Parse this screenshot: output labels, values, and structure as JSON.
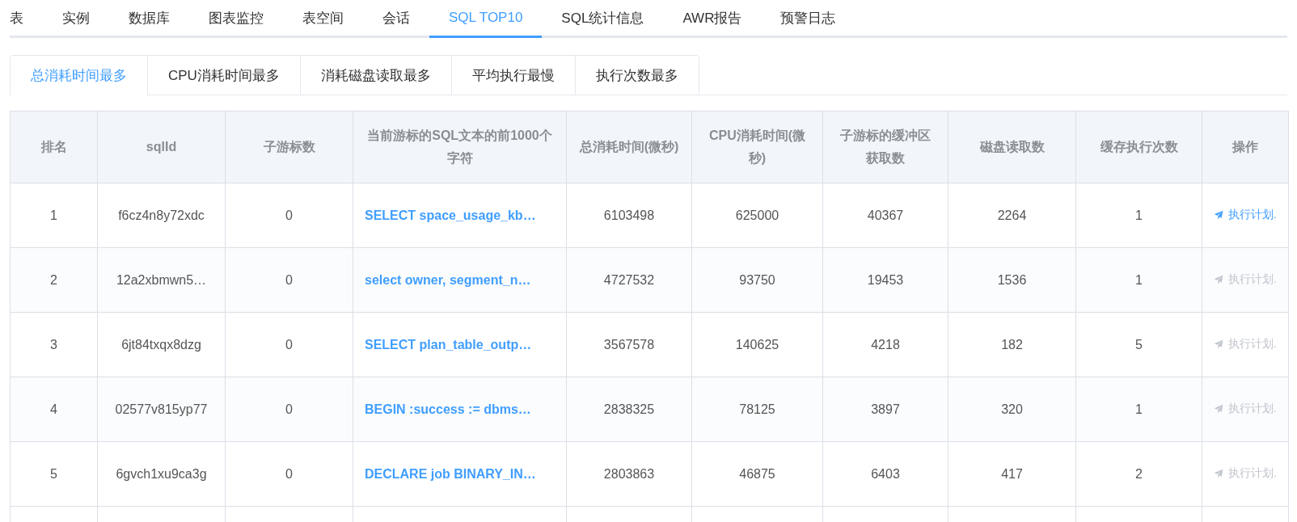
{
  "nav_tabs": [
    {
      "label": "表",
      "selected": false
    },
    {
      "label": "实例",
      "selected": false
    },
    {
      "label": "数据库",
      "selected": false
    },
    {
      "label": "图表监控",
      "selected": false
    },
    {
      "label": "表空间",
      "selected": false
    },
    {
      "label": "会话",
      "selected": false
    },
    {
      "label": "SQL TOP10",
      "selected": true
    },
    {
      "label": "SQL统计信息",
      "selected": false
    },
    {
      "label": "AWR报告",
      "selected": false
    },
    {
      "label": "预警日志",
      "selected": false
    }
  ],
  "sub_tabs": [
    {
      "label": "总消耗时间最多",
      "selected": true
    },
    {
      "label": "CPU消耗时间最多",
      "selected": false
    },
    {
      "label": "消耗磁盘读取最多",
      "selected": false
    },
    {
      "label": "平均执行最慢",
      "selected": false
    },
    {
      "label": "执行次数最多",
      "selected": false
    }
  ],
  "table": {
    "columns": [
      "排名",
      "sqlId",
      "子游标数",
      "当前游标的SQL文本的前1000个字符",
      "总消耗时间(微秒)",
      "CPU消耗时间(微秒)",
      "子游标的缓冲区获取数",
      "磁盘读取数",
      "缓存执行次数",
      "操作"
    ],
    "rows": [
      {
        "rank": "1",
        "sql_id": "f6cz4n8y72xdc",
        "child_cursors": "0",
        "sql_text": "SELECT space_usage_kb…",
        "total_time": "6103498",
        "cpu_time": "625000",
        "buffer_gets": "40367",
        "disk_reads": "2264",
        "executions": "1",
        "action": "执行计划.",
        "action_disabled": false
      },
      {
        "rank": "2",
        "sql_id": "12a2xbmwn5…",
        "child_cursors": "0",
        "sql_text": "select owner, segment_n…",
        "total_time": "4727532",
        "cpu_time": "93750",
        "buffer_gets": "19453",
        "disk_reads": "1536",
        "executions": "1",
        "action": "执行计划.",
        "action_disabled": true
      },
      {
        "rank": "3",
        "sql_id": "6jt84txqx8dzg",
        "child_cursors": "0",
        "sql_text": "SELECT plan_table_outp…",
        "total_time": "3567578",
        "cpu_time": "140625",
        "buffer_gets": "4218",
        "disk_reads": "182",
        "executions": "5",
        "action": "执行计划.",
        "action_disabled": true
      },
      {
        "rank": "4",
        "sql_id": "02577v815yp77",
        "child_cursors": "0",
        "sql_text": "BEGIN :success := dbms…",
        "total_time": "2838325",
        "cpu_time": "78125",
        "buffer_gets": "3897",
        "disk_reads": "320",
        "executions": "1",
        "action": "执行计划.",
        "action_disabled": true
      },
      {
        "rank": "5",
        "sql_id": "6gvch1xu9ca3g",
        "child_cursors": "0",
        "sql_text": "DECLARE job BINARY_IN…",
        "total_time": "2803863",
        "cpu_time": "46875",
        "buffer_gets": "6403",
        "disk_reads": "417",
        "executions": "2",
        "action": "执行计划.",
        "action_disabled": true
      }
    ]
  }
}
